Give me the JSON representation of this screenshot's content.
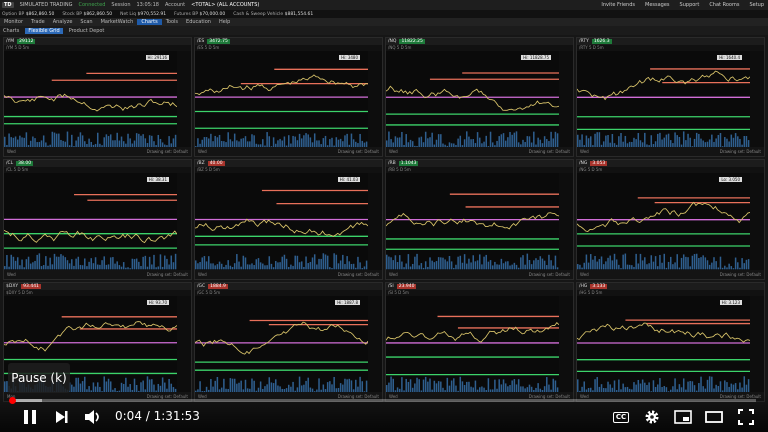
{
  "topbar": {
    "logo": "TD",
    "mode": "SIMULATED TRADING",
    "connected": "Connected",
    "session": "Session",
    "time": "13:05:18",
    "account_label": "Account",
    "account_value": "<TOTAL> (ALL ACCOUNTS)",
    "links": [
      "Invite Friends",
      "Messages",
      "Support",
      "Chat Rooms",
      "Setup"
    ]
  },
  "account_bar": {
    "items": [
      {
        "label": "Option BP",
        "value": "$862,860.50"
      },
      {
        "label": "Stock BP",
        "value": "$862,860.50"
      },
      {
        "label": "Net Liq",
        "value": "$970,552.91"
      },
      {
        "label": "Futures BP",
        "value": "$70,000.00"
      },
      {
        "label": "Cash & Sweep Vehicle",
        "value": "$881,554.61"
      }
    ]
  },
  "menu": {
    "items": [
      "Monitor",
      "Trade",
      "Analyze",
      "Scan",
      "MarketWatch",
      "Charts",
      "Tools",
      "Education",
      "Help"
    ],
    "active": "Charts"
  },
  "subtabs": {
    "items": [
      "Charts",
      "Flexible Grid",
      "Product Depot"
    ],
    "active": "Flexible Grid"
  },
  "panels": [
    {
      "sym": "/YM",
      "price": "29112",
      "dir": "up",
      "tf": "/YM 5 D 5m",
      "tag": "Hi: 29116",
      "drawing": "Drawing set: Default",
      "footer_left": "Wed",
      "color": "up"
    },
    {
      "sym": "/ES",
      "price": "3472.75",
      "dir": "up",
      "tf": "/ES 5 D 5m",
      "tag": "Hi: 3480",
      "drawing": "Drawing set: Default",
      "footer_left": "Wed",
      "color": "up"
    },
    {
      "sym": "/NQ",
      "price": "11822.25",
      "dir": "up",
      "tf": "/NQ 5 D 5m",
      "tag": "Hi: 11828.75",
      "drawing": "Drawing set: Default",
      "footer_left": "Wed",
      "color": "up"
    },
    {
      "sym": "/RTY",
      "price": "1626.3",
      "dir": "up",
      "tf": "/RTY 5 D 5m",
      "tag": "Hi: 1640.4",
      "drawing": "Drawing set: Default",
      "footer_left": "Wed",
      "color": "up"
    },
    {
      "sym": "/CL",
      "price": "38.00",
      "dir": "up",
      "tf": "/CL 5 D 5m",
      "tag": "Hi: 38.31",
      "drawing": "Drawing set: Default",
      "footer_left": "Wed",
      "color": "up"
    },
    {
      "sym": "/BZ",
      "price": "40.00",
      "dir": "dn",
      "tf": "/BZ 5 D 5m",
      "tag": "Hi: 41.03",
      "drawing": "Drawing set: Default",
      "footer_left": "Wed",
      "color": "dn"
    },
    {
      "sym": "/RB",
      "price": "1.1043",
      "dir": "up",
      "tf": "/RB 5 D 5m",
      "tag": "",
      "drawing": "Drawing set: Default",
      "footer_left": "Wed",
      "color": "up"
    },
    {
      "sym": "/NG",
      "price": "3.053",
      "dir": "dn",
      "tf": "/NG 5 D 5m",
      "tag": "Lo: 3.050",
      "drawing": "Drawing set: Default",
      "footer_left": "Wed",
      "color": "dn"
    },
    {
      "sym": "$DXY",
      "price": "93.441",
      "dir": "dn",
      "tf": "$DXY 5 D 5m",
      "tag": "Hi: 93.70",
      "drawing": "Drawing set: Default",
      "footer_left": "Mon",
      "color": "dn"
    },
    {
      "sym": "/GC",
      "price": "1884.9",
      "dir": "dn",
      "tf": "/GC 5 D 5m",
      "tag": "Hi: 1887.8",
      "drawing": "Drawing set: Default",
      "footer_left": "Wed",
      "color": "dn"
    },
    {
      "sym": "/SI",
      "price": "23.940",
      "dir": "dn",
      "tf": "/SI 5 D 5m",
      "tag": "",
      "drawing": "Drawing set: Default",
      "footer_left": "Wed",
      "color": "dn"
    },
    {
      "sym": "/HG",
      "price": "3.133",
      "dir": "dn",
      "tf": "/HG 5 D 5m",
      "tag": "Hi: 3.123",
      "drawing": "Drawing set: Default",
      "footer_left": "Wed",
      "color": "dn"
    }
  ],
  "video": {
    "pause_tooltip": "Pause (k)",
    "time": "0:04 / 1:31:53",
    "progress": 0.0007,
    "buffered": 0.04,
    "cc_label": "CC"
  },
  "colors": {
    "accent": "#1e5aa8",
    "progress": "#ff0000",
    "up": "#1e7a3a",
    "dn": "#a8342c"
  }
}
